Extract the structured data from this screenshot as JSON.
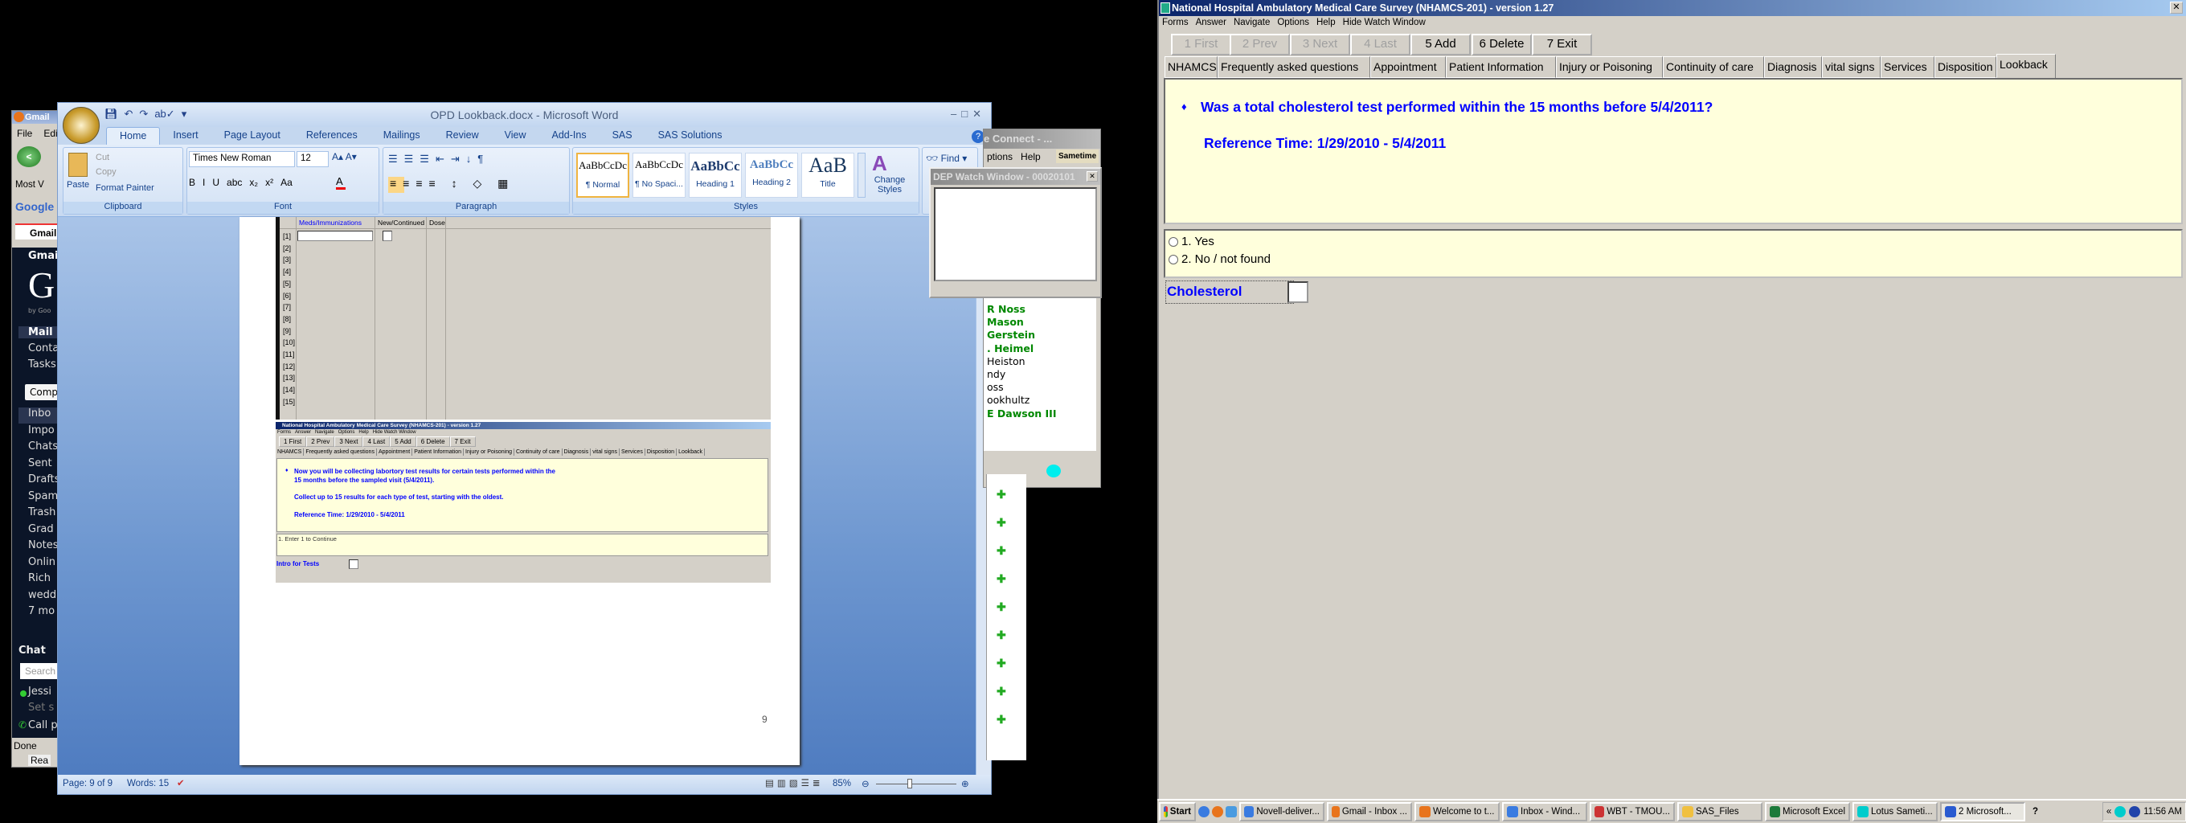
{
  "gmail": {
    "title": "Gmail",
    "menu": [
      "File",
      "Edit"
    ],
    "bookmark": "Most V",
    "search_engine": "Google",
    "tab": "Gmail",
    "header": "Gmail",
    "logo": "G",
    "logo_sub": "by Goo",
    "nav": [
      "Mail",
      "Conta",
      "Tasks"
    ],
    "compose": "Comp",
    "folders": [
      "Inbo",
      "Impo",
      "Chats",
      "Sent",
      "Drafts",
      "Spam",
      "Trash",
      "Grad",
      "Notes",
      "Onlin",
      "Rich",
      "wedd",
      "7 mo"
    ],
    "chat": {
      "title": "Chat",
      "search_placeholder": "Search",
      "contact": "Jessi",
      "status": "Set s",
      "call": "Call p"
    },
    "status": "Done",
    "bottom_fragment": "Rea"
  },
  "word": {
    "title": "OPD Lookback.docx - Microsoft Word",
    "tabs": [
      "Home",
      "Insert",
      "Page Layout",
      "References",
      "Mailings",
      "Review",
      "View",
      "Add-Ins",
      "SAS",
      "SAS Solutions"
    ],
    "active_tab": "Home",
    "clipboard": {
      "paste": "Paste",
      "cut": "Cut",
      "copy": "Copy",
      "format_painter": "Format Painter",
      "label": "Clipboard"
    },
    "font": {
      "name": "Times New Roman",
      "size": "12",
      "label": "Font",
      "buttons": [
        "B",
        "I",
        "U",
        "abc",
        "x₂",
        "x²",
        "Aa"
      ]
    },
    "paragraph": {
      "label": "Paragraph"
    },
    "styles": {
      "label": "Styles",
      "items": [
        {
          "preview": "AaBbCcDc",
          "name": "¶ Normal"
        },
        {
          "preview": "AaBbCcDc",
          "name": "¶ No Spaci..."
        },
        {
          "preview": "AaBbCc",
          "name": "Heading 1"
        },
        {
          "preview": "AaBbCc",
          "name": "Heading 2"
        },
        {
          "preview": "AaB",
          "name": "Title"
        }
      ],
      "change_styles": "Change Styles"
    },
    "editing": {
      "find": "Find"
    },
    "document": {
      "table_headers": [
        "Meds/Immunizations",
        "New/Continued",
        "Dose"
      ],
      "row_labels": [
        "[1]",
        "[2]",
        "[3]",
        "[4]",
        "[5]",
        "[6]",
        "[7]",
        "[8]",
        "[9]",
        "[10]",
        "[11]",
        "[12]",
        "[13]",
        "[14]",
        "[15]"
      ],
      "embedded_app": {
        "title": "National Hospital Ambulatory Medical Care Survey (NHAMCS-201) - version 1.27",
        "menu": [
          "Forms",
          "Answer",
          "Navigate",
          "Options",
          "Help",
          "Hide Watch Window"
        ],
        "buttons": [
          "1 First",
          "2 Prev",
          "3 Next",
          "4 Last",
          "5 Add",
          "6 Delete",
          "7 Exit"
        ],
        "tabs": [
          "NHAMCS",
          "Frequently asked questions",
          "Appointment",
          "Patient Information",
          "Injury or Poisoning",
          "Continuity of care",
          "Diagnosis",
          "vital signs",
          "Services",
          "Disposition",
          "Lookback"
        ],
        "line1": "Now you will be collecting labortory test results for certain tests performed within the",
        "line2": "15 months before the sampled visit (5/4/2011).",
        "line3": "Collect up to 15 results for each type of test, starting with the oldest.",
        "line4": "Reference Time: 1/29/2010 - 5/4/2011",
        "option": "1. Enter 1 to Continue",
        "field_label": "Intro for Tests"
      },
      "page_number": "9"
    },
    "status": {
      "page": "Page: 9 of 9",
      "words": "Words: 15",
      "zoom": "85%",
      "zoom_value": 85
    }
  },
  "sametime": {
    "title": "e Connect - ...",
    "menu": [
      "ptions",
      "Help"
    ],
    "brand": "Sametime",
    "contacts": [
      {
        "name": "R Noss",
        "online": true
      },
      {
        "name": "Mason",
        "online": true
      },
      {
        "name": "Gerstein",
        "online": true
      },
      {
        "name": ". Heimel",
        "online": true
      },
      {
        "name": "Heiston",
        "online": false
      },
      {
        "name": "ndy",
        "online": false
      },
      {
        "name": "oss",
        "online": false
      },
      {
        "name": "ookhultz",
        "online": false
      },
      {
        "name": "E Dawson III",
        "online": true
      }
    ]
  },
  "dep_watch": {
    "title": "DEP Watch Window - 00020101"
  },
  "nhamcs": {
    "title": "National Hospital Ambulatory Medical Care Survey (NHAMCS-201) - version 1.27",
    "menu": [
      "Forms",
      "Answer",
      "Navigate",
      "Options",
      "Help",
      "Hide Watch Window"
    ],
    "buttons": [
      {
        "label": "1 First",
        "enabled": false
      },
      {
        "label": "2 Prev",
        "enabled": false
      },
      {
        "label": "3 Next",
        "enabled": false
      },
      {
        "label": "4 Last",
        "enabled": false
      },
      {
        "label": "5 Add",
        "enabled": true
      },
      {
        "label": "6 Delete",
        "enabled": true
      },
      {
        "label": "7 Exit",
        "enabled": true
      }
    ],
    "tabs": [
      "NHAMCS",
      "Frequently asked questions",
      "Appointment",
      "Patient Information",
      "Injury or Poisoning",
      "Continuity of care",
      "Diagnosis",
      "vital signs",
      "Services",
      "Disposition",
      "Lookback"
    ],
    "active_tab": "Lookback",
    "question": "Was a total cholesterol test performed within the 15 months before 5/4/2011?",
    "reference": "Reference Time: 1/29/2010 - 5/4/2011",
    "options": [
      "1.  Yes",
      "2.  No / not found"
    ],
    "field_label": "Cholesterol",
    "field_value": "",
    "text_color": "#0000ff",
    "panel_color": "#ffffdc"
  },
  "taskbar": {
    "start": "Start",
    "items": [
      "Novell-deliver...",
      "Gmail - Inbox ...",
      "Welcome to t...",
      "Inbox - Wind...",
      "WBT - TMOU...",
      "SAS_Files",
      "Microsoft Excel",
      "Lotus Sameti...",
      "2 Microsoft..."
    ],
    "clock": "11:56 AM"
  }
}
